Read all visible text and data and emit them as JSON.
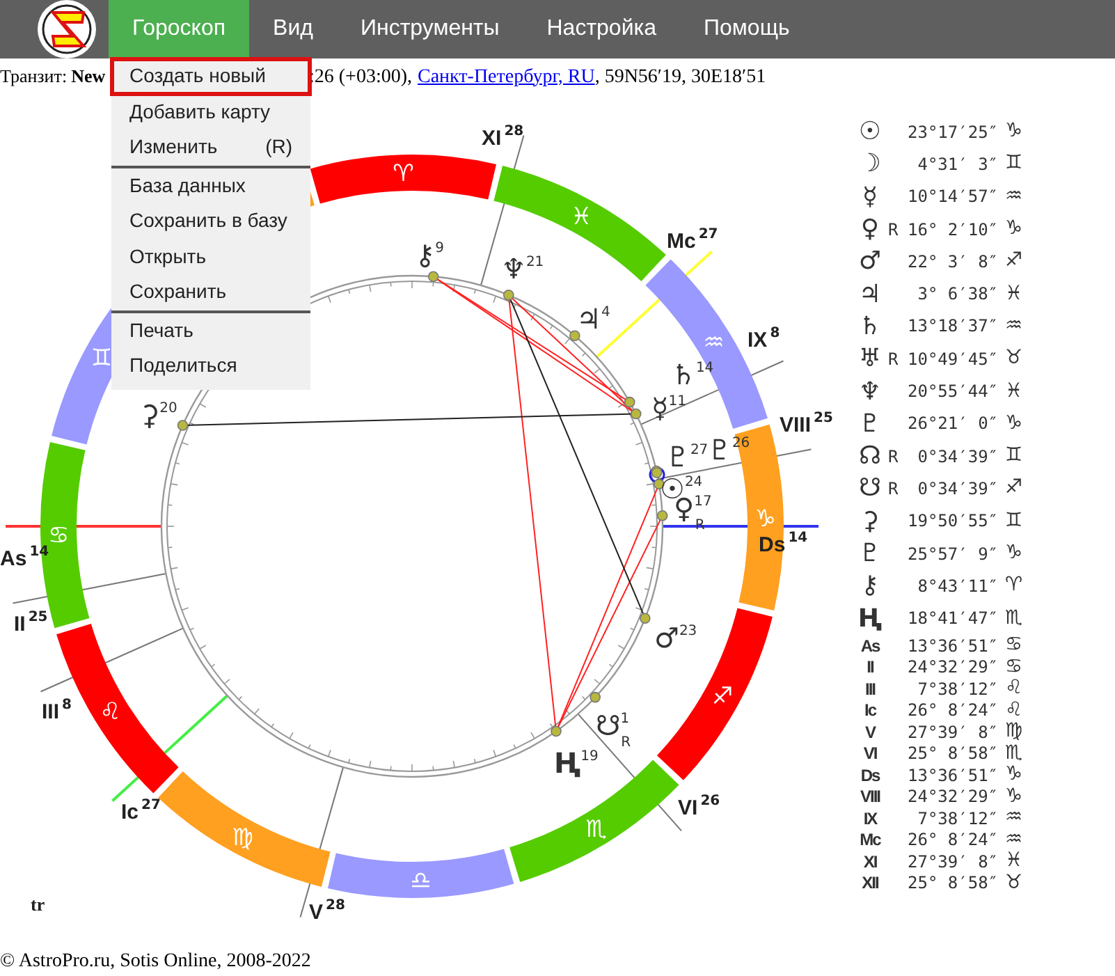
{
  "nav": {
    "items": [
      {
        "label": "Гороскоп",
        "selected": true
      },
      {
        "label": "Вид",
        "selected": false
      },
      {
        "label": "Инструменты",
        "selected": false
      },
      {
        "label": "Настройка",
        "selected": false
      },
      {
        "label": "Помощь",
        "selected": false
      }
    ]
  },
  "info": {
    "prefix": "Транзит:",
    "name": "New",
    "time": ":26 (+03:00),",
    "place": "Санкт-Петербург, RU",
    "coords": ", 59N56′19, 30E18′51"
  },
  "menu": {
    "groups": [
      [
        {
          "label": "Создать новый",
          "selected": true
        },
        {
          "label": "Добавить карту",
          "selected": false
        },
        {
          "label": "Изменить",
          "shortcut": "(R)",
          "selected": false
        }
      ],
      [
        {
          "label": "База данных",
          "selected": false
        },
        {
          "label": "Сохранить в базу",
          "selected": false
        },
        {
          "label": "Открыть",
          "selected": false
        },
        {
          "label": "Сохранить",
          "selected": false
        }
      ],
      [
        {
          "label": "Печать",
          "selected": false
        },
        {
          "label": "Поделиться",
          "selected": false
        }
      ]
    ]
  },
  "wheel": {
    "signs": [
      {
        "glyph": "♈",
        "color": "#ff0000"
      },
      {
        "color": "#ffa020"
      },
      {
        "glyph": "♊",
        "color": "#9999ff"
      },
      {
        "glyph": "♋",
        "color": "#55cc00"
      },
      {
        "glyph": "♌",
        "color": "#ff0000"
      },
      {
        "glyph": "♍",
        "color": "#ffa020"
      },
      {
        "glyph": "♎",
        "color": "#9999ff"
      },
      {
        "glyph": "♏",
        "color": "#55cc00"
      },
      {
        "glyph": "♐",
        "color": "#ff0000"
      },
      {
        "glyph": "♑",
        "color": "#ffa020"
      },
      {
        "glyph": "♒",
        "color": "#9999ff"
      },
      {
        "glyph": "♓",
        "color": "#55cc00"
      }
    ],
    "cusps": [
      {
        "label": "As",
        "degree": "14"
      },
      {
        "label": "II",
        "degree": "25"
      },
      {
        "label": "III",
        "degree": "8"
      },
      {
        "label": "Ic",
        "degree": "27"
      },
      {
        "label": "V",
        "degree": "28"
      },
      {
        "label": "VI",
        "degree": "26"
      },
      {
        "label": "Ds",
        "degree": "14"
      },
      {
        "label": "VIII",
        "degree": "25"
      },
      {
        "label": "IX",
        "degree": "8"
      },
      {
        "label": "Mc",
        "degree": "27"
      },
      {
        "label": "XI",
        "degree": "28"
      }
    ],
    "planets": [
      {
        "glyph": "⚷",
        "degree": "9"
      },
      {
        "glyph": "♆",
        "degree": "21"
      },
      {
        "glyph": "♃",
        "degree": "4"
      },
      {
        "glyph": "♄",
        "degree": "14"
      },
      {
        "glyph": "☿",
        "degree": "11"
      },
      {
        "glyph": "♇",
        "degree": "27"
      },
      {
        "glyph": "♇",
        "degree": "26"
      },
      {
        "glyph": "☉",
        "degree": "24"
      },
      {
        "glyph": "♀",
        "degree": "17",
        "flag": "R"
      },
      {
        "glyph": "♂",
        "degree": "23"
      },
      {
        "glyph": "☋",
        "degree": "1",
        "flag": "R"
      },
      {
        "glyph": "Ⱨ",
        "degree": "19"
      },
      {
        "glyph": "⚳",
        "degree": "20"
      }
    ],
    "corner_label": "tr"
  },
  "positions": [
    {
      "kind": "planet",
      "glyph": "☉",
      "value": "23°17′25″",
      "sign": "♑"
    },
    {
      "kind": "planet",
      "glyph": "☽",
      "value": " 4°31′ 3″",
      "sign": "♊"
    },
    {
      "kind": "planet",
      "glyph": "☿",
      "value": "10°14′57″",
      "sign": "♒"
    },
    {
      "kind": "planet",
      "glyph": "♀",
      "flag": "R",
      "value": "16° 2′10″",
      "sign": "♑"
    },
    {
      "kind": "planet",
      "glyph": "♂",
      "value": "22° 3′ 8″",
      "sign": "♐"
    },
    {
      "kind": "planet",
      "glyph": "♃",
      "value": " 3° 6′38″",
      "sign": "♓"
    },
    {
      "kind": "planet",
      "glyph": "♄",
      "value": "13°18′37″",
      "sign": "♒"
    },
    {
      "kind": "planet",
      "glyph": "♅",
      "flag": "R",
      "value": "10°49′45″",
      "sign": "♉"
    },
    {
      "kind": "planet",
      "glyph": "♆",
      "value": "20°55′44″",
      "sign": "♓"
    },
    {
      "kind": "planet",
      "glyph": "♇",
      "value": "26°21′ 0″",
      "sign": "♑"
    },
    {
      "kind": "planet",
      "glyph": "☊",
      "flag": "R",
      "value": " 0°34′39″",
      "sign": "♊"
    },
    {
      "kind": "planet",
      "glyph": "☋",
      "flag": "R",
      "value": " 0°34′39″",
      "sign": "♐"
    },
    {
      "kind": "planet",
      "glyph": "⚳",
      "value": "19°50′55″",
      "sign": "♊"
    },
    {
      "kind": "planet",
      "glyph": "♇",
      "value": "25°57′ 9″",
      "sign": "♑"
    },
    {
      "kind": "planet",
      "glyph": "⚷",
      "value": " 8°43′11″",
      "sign": "♈"
    },
    {
      "kind": "planet",
      "glyph": "Ⱨ",
      "value": "18°41′47″",
      "sign": "♏"
    },
    {
      "kind": "house",
      "glyph": "As",
      "value": "13°36′51″",
      "sign": "♋"
    },
    {
      "kind": "house",
      "glyph": "II",
      "value": "24°32′29″",
      "sign": "♋"
    },
    {
      "kind": "house",
      "glyph": "III",
      "value": " 7°38′12″",
      "sign": "♌"
    },
    {
      "kind": "house",
      "glyph": "Ic",
      "value": "26° 8′24″",
      "sign": "♌"
    },
    {
      "kind": "house",
      "glyph": "V",
      "value": "27°39′ 8″",
      "sign": "♍"
    },
    {
      "kind": "house",
      "glyph": "VI",
      "value": "25° 8′58″",
      "sign": "♏"
    },
    {
      "kind": "house",
      "glyph": "Ds",
      "value": "13°36′51″",
      "sign": "♑"
    },
    {
      "kind": "house",
      "glyph": "VIII",
      "value": "24°32′29″",
      "sign": "♑"
    },
    {
      "kind": "house",
      "glyph": "IX",
      "value": " 7°38′12″",
      "sign": "♒"
    },
    {
      "kind": "house",
      "glyph": "Mc",
      "value": "26° 8′24″",
      "sign": "♒"
    },
    {
      "kind": "house",
      "glyph": "XI",
      "value": "27°39′ 8″",
      "sign": "♓"
    },
    {
      "kind": "house",
      "glyph": "XII",
      "value": "25° 8′58″",
      "sign": "♉"
    }
  ],
  "footer": "© AstroPro.ru, Sotis Online, 2008-2022"
}
